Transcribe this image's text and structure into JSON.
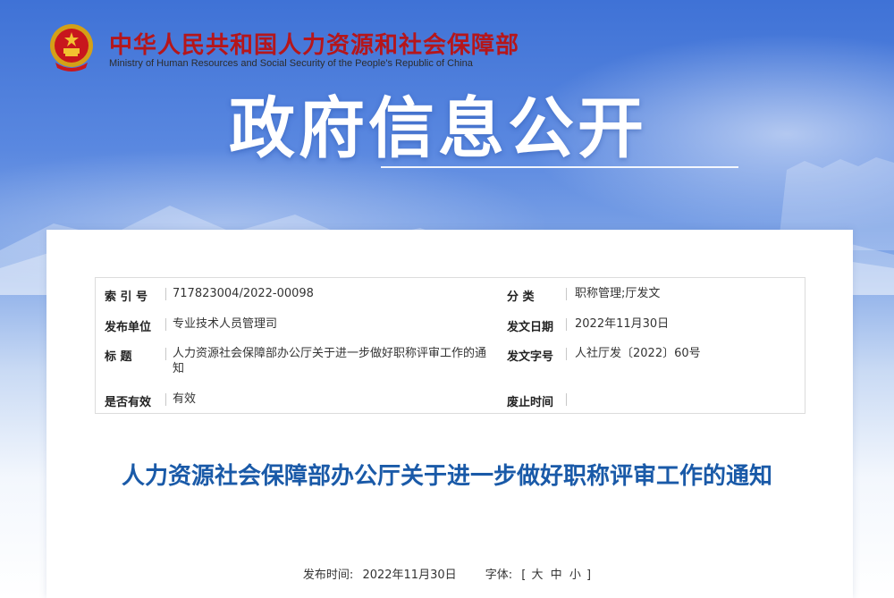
{
  "header": {
    "ministry_cn": "中华人民共和国人力资源和社会保障部",
    "ministry_en": "Ministry of Human Resources and Social Security of the People's Republic of China",
    "section_title": "政府信息公开",
    "emblem_icon": "national-emblem-icon"
  },
  "meta": {
    "index_label": "索 引 号",
    "index_value": "717823004/2022-00098",
    "category_label": "分    类",
    "category_value": "职称管理;厅发文",
    "publisher_label": "发布单位",
    "publisher_value": "专业技术人员管理司",
    "issue_date_label": "发文日期",
    "issue_date_value": "2022年11月30日",
    "title_label": "标    题",
    "title_value": "人力资源社会保障部办公厅关于进一步做好职称评审工作的通知",
    "doc_number_label": "发文字号",
    "doc_number_value": "人社厅发〔2022〕60号",
    "valid_label": "是否有效",
    "valid_value": "有效",
    "abolish_label": "废止时间",
    "abolish_value": ""
  },
  "document": {
    "title": "人力资源社会保障部办公厅关于进一步做好职称评审工作的通知",
    "publish_time_label": "发布时间:",
    "publish_time_value": "2022年11月30日",
    "font_label": "字体:",
    "font_open": "[",
    "font_large": "大",
    "font_medium": "中",
    "font_small": "小",
    "font_close": "]"
  },
  "colors": {
    "ministry_red": "#b5161b",
    "title_blue": "#1a5aa8",
    "banner_blue": "#3f72d6"
  }
}
